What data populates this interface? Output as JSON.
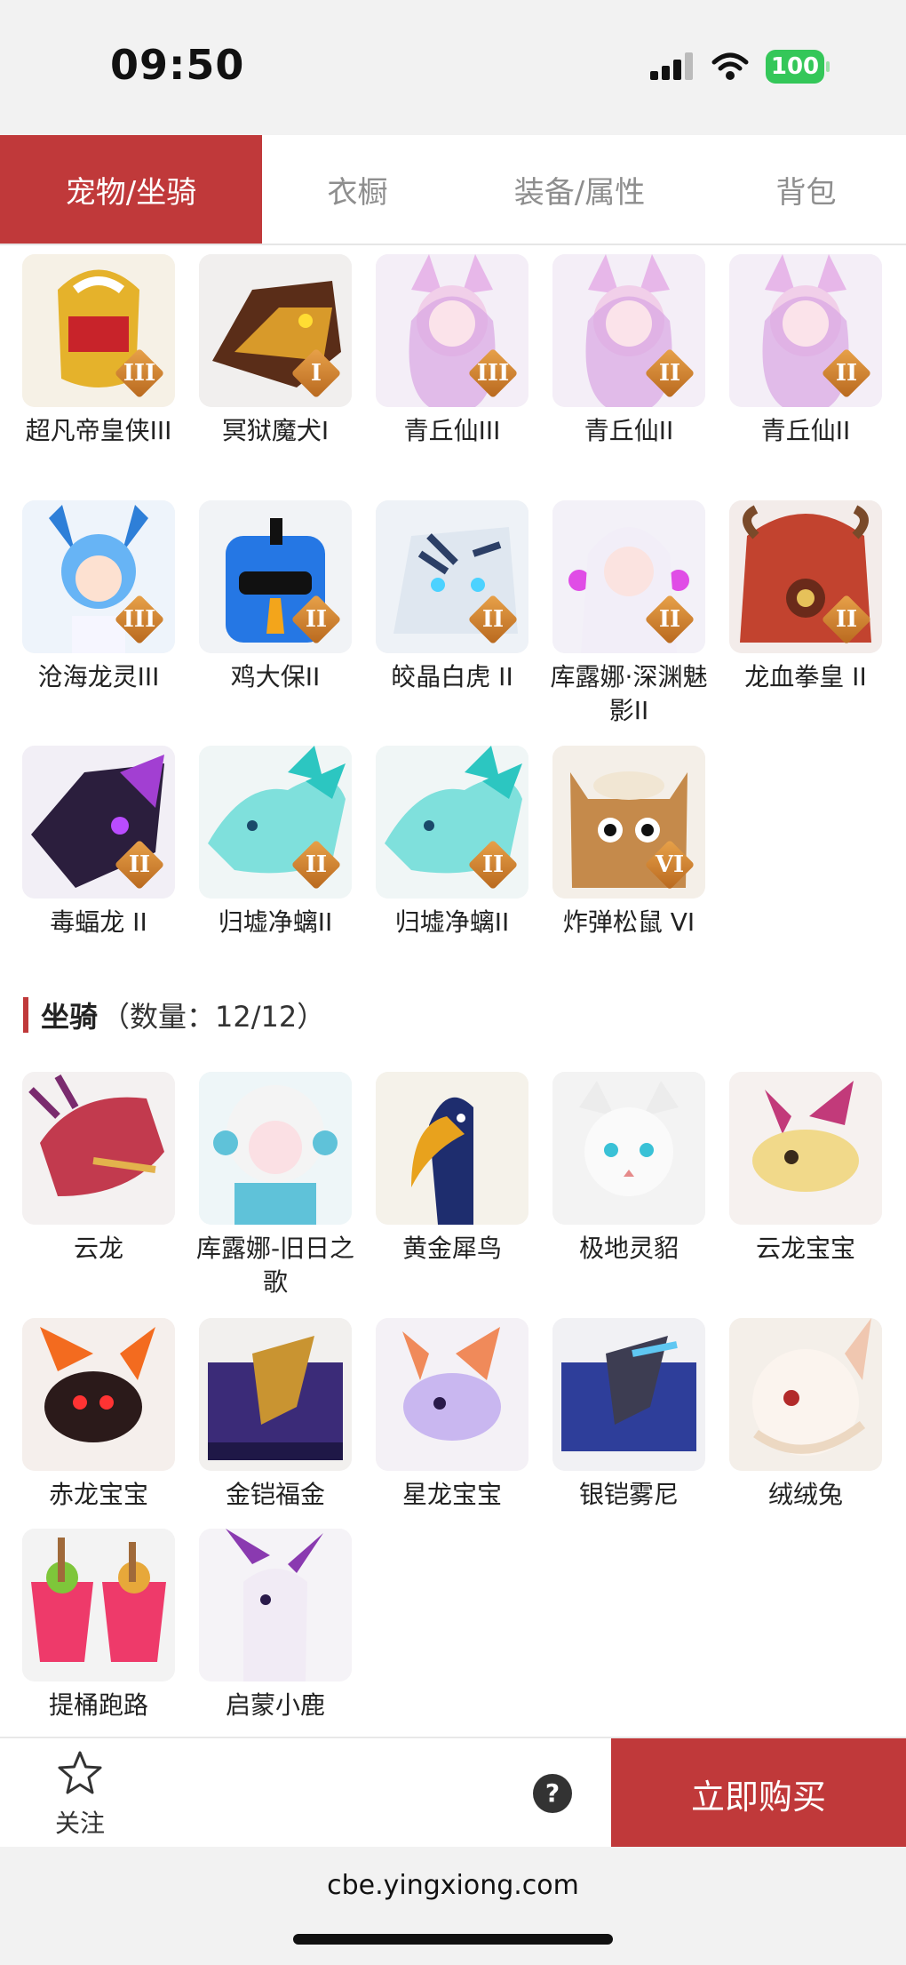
{
  "status": {
    "time": "09:50",
    "battery": "100"
  },
  "tabs": [
    {
      "label": "宠物/坐骑",
      "active": true
    },
    {
      "label": "衣橱",
      "active": false
    },
    {
      "label": "装备/属性",
      "active": false
    },
    {
      "label": "背包",
      "active": false
    }
  ],
  "pets": [
    {
      "name": "超凡帝皇侠III",
      "tier": "III",
      "art": "gold-helmet"
    },
    {
      "name": "冥狱魔犬I",
      "tier": "I",
      "art": "hellhound"
    },
    {
      "name": "青丘仙III",
      "tier": "III",
      "art": "fox-fairy"
    },
    {
      "name": "青丘仙II",
      "tier": "II",
      "art": "fox-fairy"
    },
    {
      "name": "青丘仙II",
      "tier": "II",
      "art": "fox-fairy"
    },
    {
      "name": "沧海龙灵III",
      "tier": "III",
      "art": "blue-dragon-spirit"
    },
    {
      "name": "鸡大保II",
      "tier": "II",
      "art": "blue-bird"
    },
    {
      "name": "皎晶白虎 II",
      "tier": "II",
      "art": "white-tiger"
    },
    {
      "name": "库露娜·深渊魅影II",
      "tier": "II",
      "art": "white-hair-girl"
    },
    {
      "name": "龙血拳皇 II",
      "tier": "II",
      "art": "red-beast"
    },
    {
      "name": "毒蝠龙 II",
      "tier": "II",
      "art": "purple-dragon"
    },
    {
      "name": "归墟净螭II",
      "tier": "II",
      "art": "cyan-dragon"
    },
    {
      "name": "归墟净螭II",
      "tier": "II",
      "art": "cyan-dragon"
    },
    {
      "name": "炸弹松鼠 VI",
      "tier": "VI",
      "art": "squirrel"
    }
  ],
  "mounts_section": {
    "title": "坐骑",
    "count": "（数量：12/12）"
  },
  "mounts": [
    {
      "name": "云龙",
      "art": "red-dragon"
    },
    {
      "name": "库露娜-旧日之歌",
      "art": "sheep-girl"
    },
    {
      "name": "黄金犀鸟",
      "art": "hornbill"
    },
    {
      "name": "极地灵貂",
      "art": "white-fox"
    },
    {
      "name": "云龙宝宝",
      "art": "baby-dragon-gold"
    },
    {
      "name": "赤龙宝宝",
      "art": "baby-dragon-red"
    },
    {
      "name": "金铠福金",
      "art": "armor-gold"
    },
    {
      "name": "星龙宝宝",
      "art": "baby-dragon-star"
    },
    {
      "name": "银铠雾尼",
      "art": "armor-silver"
    },
    {
      "name": "绒绒兔",
      "art": "white-rabbit"
    },
    {
      "name": "提桶跑路",
      "art": "buckets"
    },
    {
      "name": "启蒙小鹿",
      "art": "white-deer"
    }
  ],
  "bottom": {
    "follow_label": "关注",
    "help": "?",
    "buy_label": "立即购买"
  },
  "address": {
    "url": "cbe.yingxiong.com"
  }
}
